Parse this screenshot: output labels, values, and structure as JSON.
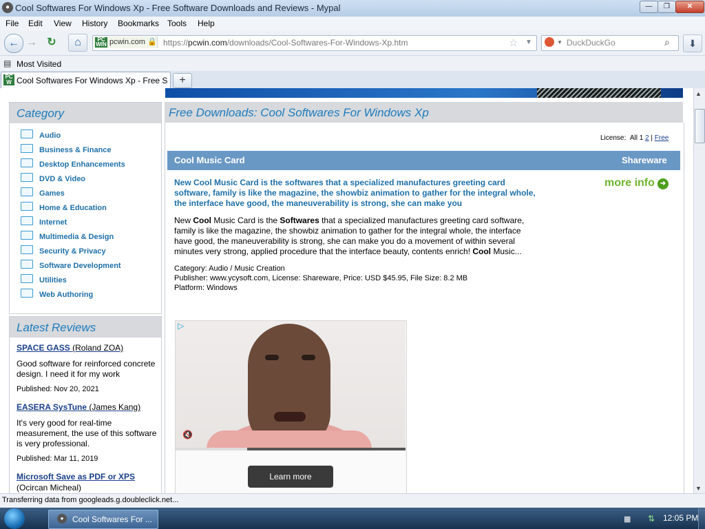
{
  "window": {
    "title": "Cool Softwares For Windows Xp - Free Software Downloads and Reviews - Mypal",
    "controls": {
      "minimize": "—",
      "maximize": "❐",
      "close": "✕"
    }
  },
  "menu": [
    "File",
    "Edit",
    "View",
    "History",
    "Bookmarks",
    "Tools",
    "Help"
  ],
  "nav": {
    "site_identity": "pcwin.com",
    "url_prefix": "https://",
    "url_domain": "pcwin.com",
    "url_path": "/downloads/Cool-Softwares-For-Windows-Xp.htm",
    "search_placeholder": "DuckDuckGo"
  },
  "bookmarks": {
    "most_visited": "Most Visited"
  },
  "tabs": [
    {
      "label": "Cool Softwares For Windows Xp - Free So..."
    }
  ],
  "sidebar": {
    "category_title": "Category",
    "categories": [
      "Audio",
      "Business & Finance",
      "Desktop Enhancements",
      "DVD & Video",
      "Games",
      "Home & Education",
      "Internet",
      "Multimedia & Design",
      "Security & Privacy",
      "Software Development",
      "Utilities",
      "Web Authoring"
    ],
    "reviews_title": "Latest Reviews",
    "reviews": [
      {
        "title": "SPACE GASS",
        "author": "(Roland ZOA)",
        "text": "Good software for reinforced concrete design. I need it for my work",
        "date": "Published: Nov 20, 2021"
      },
      {
        "title": "EASERA SysTune",
        "author": "(James Kang)",
        "text": "It's very good for real-time measurement, the use of this software is very professional.",
        "date": "Published: Mar 11, 2019"
      },
      {
        "title": "Microsoft Save as PDF or XPS",
        "author": "(Ocircan Micheal)"
      }
    ]
  },
  "main": {
    "heading": "Free Downloads: Cool Softwares For Windows Xp",
    "license_filter": {
      "label": "License:",
      "all": "All",
      "page1": "1",
      "page2": "2",
      "sep": "|",
      "free": "Free"
    },
    "product": {
      "name": "Cool Music Card",
      "license": "Shareware",
      "summary": "New Cool Music Card is the softwares that a specialized manufactures greeting card software, family is like the magazine, the showbiz animation to gather for the integral whole, the interface have good, the maneuverability is strong, she can make you",
      "more_info": "more info",
      "desc_parts": [
        "New ",
        "Cool",
        " Music Card is the ",
        "Softwares",
        " that a specialized manufactures greeting card software, family is like the magazine, the showbiz animation to gather for the integral whole, the interface have good, the maneuverability is strong, she can make you do a movement of within several minutes very strong, applied procedure that the interface beauty, contents enrich! ",
        "Cool",
        " Music..."
      ],
      "category": "Category: Audio / Music Creation",
      "publisher_line": "Publisher: www.ycysoft.com, License: Shareware, Price: USD $45.95, File Size: 8.2 MB",
      "platform": "Platform: Windows"
    },
    "ad": {
      "button": "Learn more",
      "progress": 0.31
    }
  },
  "status": "Transferring data from googleads.g.doubleclick.net...",
  "taskbar": {
    "item": "Cool Softwares For ...",
    "clock": "12:05 PM"
  }
}
